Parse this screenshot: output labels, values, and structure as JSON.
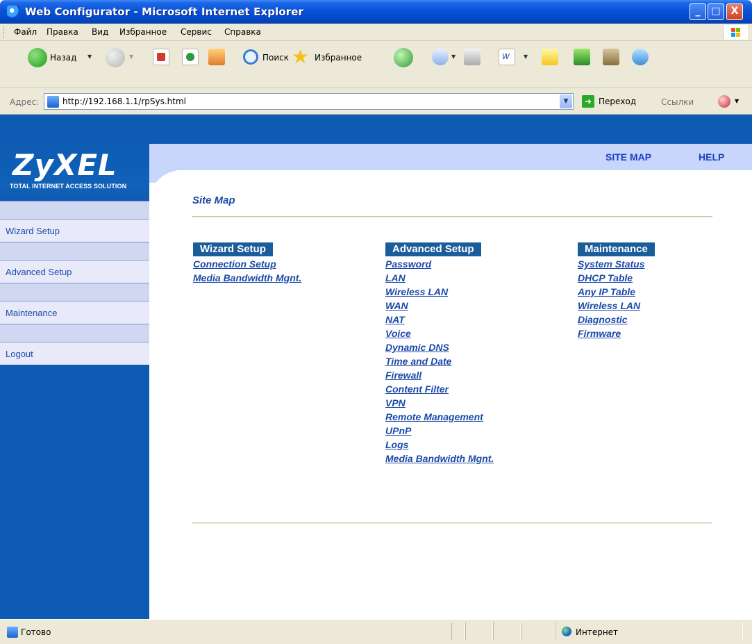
{
  "window": {
    "title": "Web Configurator - Microsoft Internet Explorer",
    "min_label": "_",
    "max_label": "□",
    "close_label": "X"
  },
  "menu": [
    "Файл",
    "Правка",
    "Вид",
    "Избранное",
    "Сервис",
    "Справка"
  ],
  "toolbar": {
    "back_label": "Назад",
    "search_label": "Поиск",
    "favorites_label": "Избранное"
  },
  "address": {
    "label": "Адрес:",
    "url": "http://192.168.1.1/rpSys.html",
    "go_label": "Переход",
    "links_label": "Ссылки"
  },
  "brand": {
    "logo": "ZyXEL",
    "tagline": "TOTAL INTERNET ACCESS SOLUTION"
  },
  "sidebar": {
    "items": [
      {
        "label": "Wizard Setup"
      },
      {
        "label": "Advanced Setup"
      },
      {
        "label": "Maintenance"
      },
      {
        "label": "Logout"
      }
    ]
  },
  "header_links": {
    "site_map": "SITE MAP",
    "help": "HELP"
  },
  "page": {
    "title": "Site Map",
    "columns": [
      {
        "header": "Wizard Setup",
        "links": [
          "Connection Setup",
          "Media Bandwidth Mgnt."
        ]
      },
      {
        "header": "Advanced Setup",
        "links": [
          "Password",
          "LAN",
          "Wireless LAN",
          "WAN",
          "NAT",
          "Voice",
          "Dynamic DNS",
          "Time and Date",
          "Firewall",
          "Content Filter",
          "VPN",
          "Remote Management",
          "UPnP",
          "Logs",
          "Media Bandwidth Mgnt."
        ]
      },
      {
        "header": "Maintenance",
        "links": [
          "System Status",
          "DHCP Table",
          "Any IP Table",
          "Wireless LAN",
          "Diagnostic",
          "Firmware"
        ]
      }
    ]
  },
  "status": {
    "text": "Готово",
    "zone": "Интернет"
  },
  "colors": {
    "sidebar_blue": "#0d5bb3",
    "link_blue": "#1c4aa8",
    "column_header": "#1b5d9b",
    "band": "#c8d6fb"
  }
}
